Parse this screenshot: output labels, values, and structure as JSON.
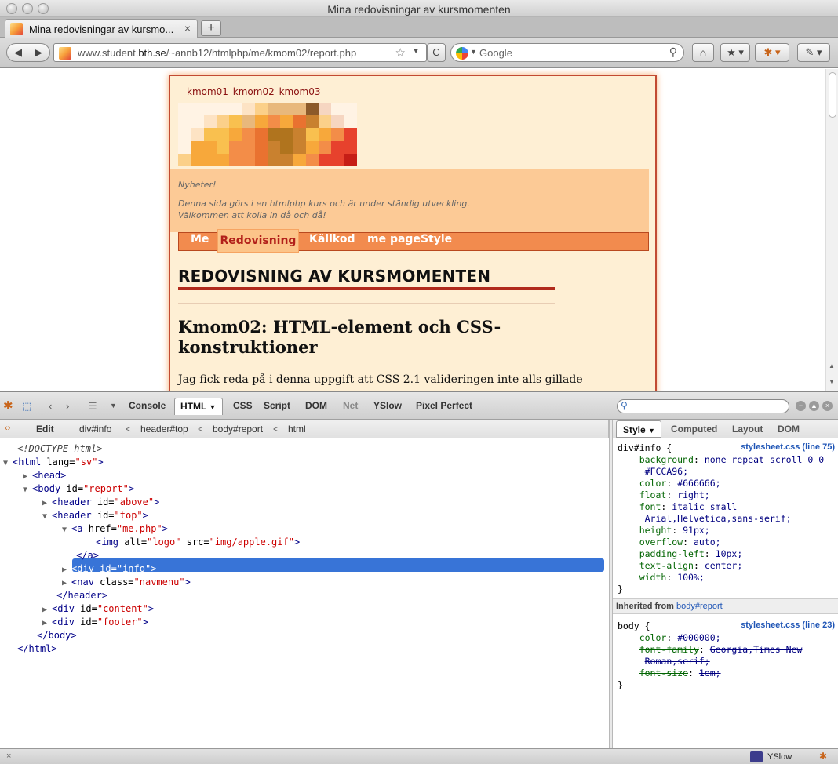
{
  "window": {
    "title": "Mina redovisningar av kursmomenten"
  },
  "tabs": [
    {
      "label": "Mina redovisningar av kursmo...",
      "close": "×"
    }
  ],
  "newtab_label": "+",
  "nav": {
    "back": "◀",
    "forward": "▶",
    "url_prefix": "www.student.",
    "url_host": "bth.se",
    "url_path": "/~annb12/htmlphp/me/kmom02/report.php",
    "search_placeholder": "Google",
    "reload": "C"
  },
  "page": {
    "top_links": [
      "kmom01",
      "kmom02",
      "kmom03"
    ],
    "info_lines": [
      "Nyheter!",
      "Denna sida görs i en htmlphp kurs och är under ständig utveckling.",
      "Välkommen att kolla in då och då!"
    ],
    "navmenu": [
      "Me",
      "Redovisning",
      "Källkod",
      "me pageStyle"
    ],
    "h1": "REDOVISNING AV KURSMOMENTEN",
    "h2": "Kmom02: HTML-element och CSS-konstruktioner",
    "paragraph": "Jag fick reda på i denna uppgift att CSS 2.1 valideringen inte alls gillade"
  },
  "firebug": {
    "tabs": [
      "Console",
      "HTML",
      "CSS",
      "Script",
      "DOM",
      "Net",
      "YSlow",
      "Pixel Perfect"
    ],
    "edit_label": "Edit",
    "breadcrumbs": [
      "div#info",
      "header#top",
      "body#report",
      "html"
    ],
    "crumb_sep": "<",
    "side_tabs": [
      "Style",
      "Computed",
      "Layout",
      "DOM"
    ],
    "tree": [
      {
        "indent": 0,
        "tri": "",
        "text": "<!DOCTYPE html>",
        "kind": "comment"
      },
      {
        "indent": 0,
        "tri": "▼",
        "tag": "html",
        "attrs": [
          [
            "lang",
            "sv"
          ]
        ],
        "close": false
      },
      {
        "indent": 1,
        "tri": "▶",
        "tag": "head",
        "attrs": [],
        "close": false
      },
      {
        "indent": 1,
        "tri": "▼",
        "tag": "body",
        "attrs": [
          [
            "id",
            "report"
          ]
        ],
        "close": false
      },
      {
        "indent": 2,
        "tri": "▶",
        "tag": "header",
        "attrs": [
          [
            "id",
            "above"
          ]
        ],
        "close": false
      },
      {
        "indent": 2,
        "tri": "▼",
        "tag": "header",
        "attrs": [
          [
            "id",
            "top"
          ]
        ],
        "close": false
      },
      {
        "indent": 3,
        "tri": "▼",
        "tag": "a",
        "attrs": [
          [
            "href",
            "me.php"
          ]
        ],
        "close": false
      },
      {
        "indent": 4,
        "tri": "",
        "tag": "img",
        "attrs": [
          [
            "alt",
            "logo"
          ],
          [
            "src",
            "img/apple.gif"
          ]
        ],
        "close": false
      },
      {
        "indent": 3,
        "tri": "",
        "text": "</a>",
        "kind": "endtag"
      },
      {
        "indent": 3,
        "tri": "▶",
        "tag": "div",
        "attrs": [
          [
            "id",
            "info"
          ]
        ],
        "close": false,
        "selected": true
      },
      {
        "indent": 3,
        "tri": "▶",
        "tag": "nav",
        "attrs": [
          [
            "class",
            "navmenu"
          ]
        ],
        "close": false
      },
      {
        "indent": 2,
        "tri": "",
        "text": "</header>",
        "kind": "endtag"
      },
      {
        "indent": 2,
        "tri": "▶",
        "tag": "div",
        "attrs": [
          [
            "id",
            "content"
          ]
        ],
        "close": false
      },
      {
        "indent": 2,
        "tri": "▶",
        "tag": "div",
        "attrs": [
          [
            "id",
            "footer"
          ]
        ],
        "close": false
      },
      {
        "indent": 1,
        "tri": "",
        "text": "</body>",
        "kind": "endtag"
      },
      {
        "indent": 0,
        "tri": "",
        "text": "</html>",
        "kind": "endtag"
      }
    ],
    "rule1": {
      "selector": "div#info {",
      "source": "stylesheet.css (line 75)",
      "lines": [
        [
          "background",
          "none repeat scroll 0 0"
        ],
        [
          "",
          "#FCCA96;"
        ],
        [
          "color",
          "#666666;"
        ],
        [
          "float",
          "right;"
        ],
        [
          "font",
          "italic small"
        ],
        [
          "",
          "Arial,Helvetica,sans-serif;"
        ],
        [
          "height",
          "91px;"
        ],
        [
          "overflow",
          "auto;"
        ],
        [
          "padding-left",
          "10px;"
        ],
        [
          "text-align",
          "center;"
        ],
        [
          "width",
          "100%;"
        ]
      ],
      "end": "}"
    },
    "inherited_label": "Inherited from",
    "inherited_from": "body#report",
    "rule2": {
      "selector": "body {",
      "source": "stylesheet.css (line 23)",
      "lines": [
        [
          "color",
          "#000000;"
        ],
        [
          "font-family",
          "Georgia,Times New"
        ],
        [
          "",
          "Roman,serif;"
        ],
        [
          "font-size",
          "1em;"
        ]
      ],
      "end": "}"
    }
  },
  "statusbar": {
    "close": "×",
    "yslow": "YSlow"
  },
  "colors": {
    "page_bg": "#FEEFD4",
    "info_bg": "#FCCA96",
    "nav_bg": "#F28B4E",
    "selection": "#3874D7"
  }
}
